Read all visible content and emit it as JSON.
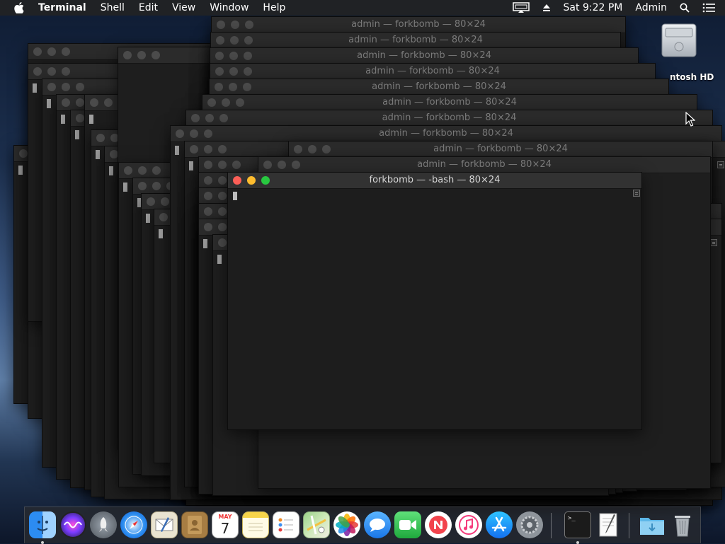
{
  "menubar": {
    "app_name": "Terminal",
    "items": [
      "Shell",
      "Edit",
      "View",
      "Window",
      "Help"
    ],
    "clock": "Sat 9:22 PM",
    "user": "Admin"
  },
  "desktop": {
    "hd_label": "ntosh HD"
  },
  "windows": {
    "background_title": "admin — forkbomb — 80×24",
    "front_title": "forkbomb — -bash — 80×24",
    "partial_title": "admin",
    "partial_title_b": "ad"
  },
  "dock": {
    "calendar_month": "MAY",
    "calendar_day": "7",
    "items": [
      "Finder",
      "Siri",
      "Launchpad",
      "Safari",
      "Mail",
      "Contacts",
      "Calendar",
      "Notes",
      "Reminders",
      "Maps",
      "Photos",
      "Messages",
      "FaceTime",
      "News",
      "iTunes",
      "App Store",
      "System Preferences",
      "Terminal",
      "TextEdit",
      "Downloads",
      "Trash"
    ]
  }
}
